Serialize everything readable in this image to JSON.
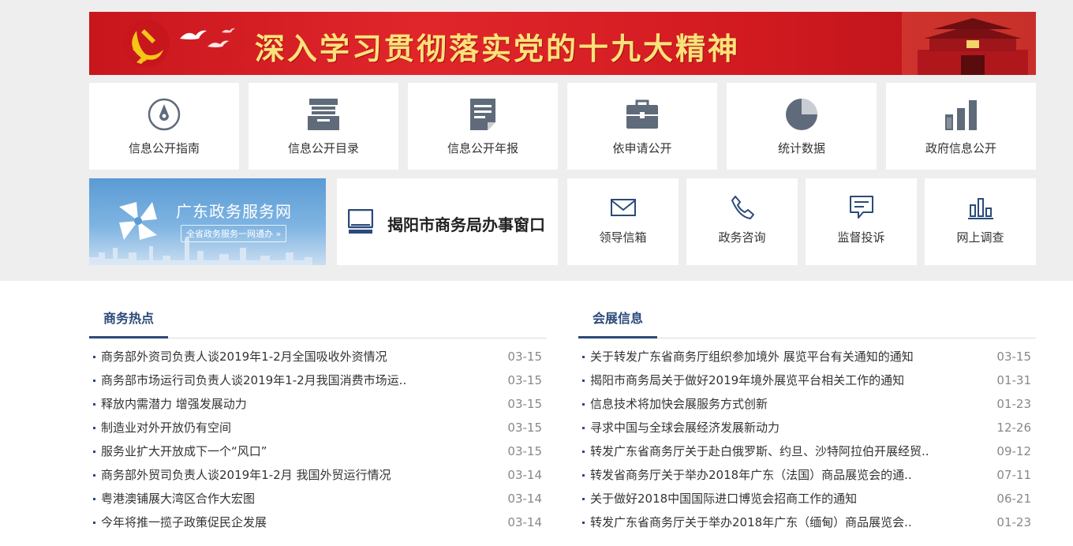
{
  "banner": {
    "title": "深入学习贯彻落实党的十九大精神"
  },
  "quick_links": [
    {
      "label": "信息公开指南",
      "icon": "compass-icon"
    },
    {
      "label": "信息公开目录",
      "icon": "file-box-icon"
    },
    {
      "label": "信息公开年报",
      "icon": "document-icon"
    },
    {
      "label": "依申请公开",
      "icon": "briefcase-icon"
    },
    {
      "label": "统计数据",
      "icon": "pie-chart-icon"
    },
    {
      "label": "政府信息公开",
      "icon": "bar-chart-icon"
    }
  ],
  "gd_service": {
    "title": "广东政务服务网",
    "subtitle": "全省政务服务一网通办 »"
  },
  "office_window": {
    "label": "揭阳市商务局办事窗口",
    "icon": "monitor-icon"
  },
  "services": [
    {
      "label": "领导信箱",
      "icon": "envelope-icon"
    },
    {
      "label": "政务咨询",
      "icon": "phone-icon"
    },
    {
      "label": "监督投诉",
      "icon": "chat-icon"
    },
    {
      "label": "网上调查",
      "icon": "survey-chart-icon"
    }
  ],
  "sections": [
    {
      "title": "商务热点",
      "items": [
        {
          "title": "商务部外资司负责人谈2019年1-2月全国吸收外资情况",
          "date": "03-15"
        },
        {
          "title": "商务部市场运行司负责人谈2019年1-2月我国消费市场运..",
          "date": "03-15"
        },
        {
          "title": "释放内需潜力 增强发展动力",
          "date": "03-15"
        },
        {
          "title": "制造业对外开放仍有空间",
          "date": "03-15"
        },
        {
          "title": "服务业扩大开放成下一个“风口”",
          "date": "03-15"
        },
        {
          "title": "商务部外贸司负责人谈2019年1-2月 我国外贸运行情况",
          "date": "03-14"
        },
        {
          "title": "粤港澳铺展大湾区合作大宏图",
          "date": "03-14"
        },
        {
          "title": "今年将推一揽子政策促民企发展",
          "date": "03-14"
        }
      ]
    },
    {
      "title": "会展信息",
      "items": [
        {
          "title": "关于转发广东省商务厅组织参加境外 展览平台有关通知的通知",
          "date": "03-15"
        },
        {
          "title": "揭阳市商务局关于做好2019年境外展览平台相关工作的通知",
          "date": "01-31"
        },
        {
          "title": "信息技术将加快会展服务方式创新",
          "date": "01-23"
        },
        {
          "title": "寻求中国与全球会展经济发展新动力",
          "date": "12-26"
        },
        {
          "title": "转发广东省商务厅关于赴白俄罗斯、约旦、沙特阿拉伯开展经贸..",
          "date": "09-12"
        },
        {
          "title": "转发省商务厅关于举办2018年广东（法国）商品展览会的通..",
          "date": "07-11"
        },
        {
          "title": "关于做好2018中国国际进口博览会招商工作的通知",
          "date": "06-21"
        },
        {
          "title": "转发广东省商务厅关于举办2018年广东（缅甸）商品展览会..",
          "date": "01-23"
        }
      ]
    }
  ]
}
